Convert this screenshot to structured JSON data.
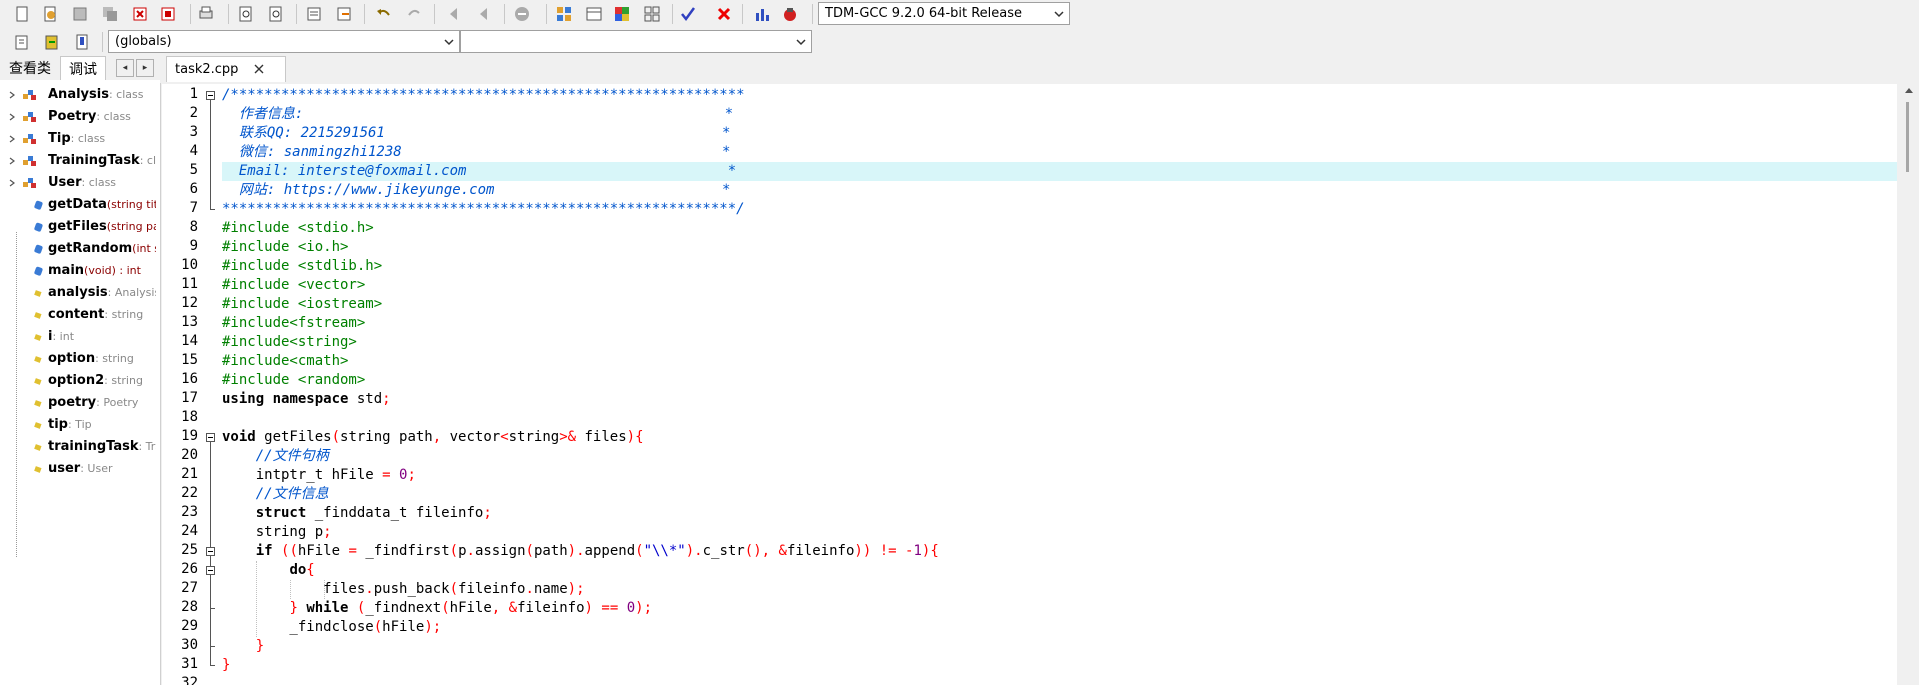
{
  "toolbar": {
    "compiler_select": "TDM-GCC 9.2.0 64-bit Release",
    "icons": [
      "new-file-icon",
      "open-file-icon",
      "save-icon",
      "save-all-icon",
      "close-icon",
      "close-all-icon",
      "print-icon",
      "find-icon",
      "replace-icon",
      "goto-icon",
      "toggle-icon",
      "undo-icon",
      "redo-icon",
      "indent-icon",
      "unindent-icon",
      "comment-icon",
      "compile-icon",
      "run-icon",
      "compile-run-icon",
      "rebuild-icon",
      "check-syntax-icon",
      "stop-icon",
      "chart-icon",
      "debug-icon"
    ]
  },
  "toolbar2": {
    "scope_select": "(globals)",
    "member_select": "",
    "icons": [
      "class-browser-icon",
      "goto-declaration-icon",
      "bookmark-icon"
    ]
  },
  "left_panel": {
    "tabs": [
      "查看类",
      "调试"
    ],
    "items": [
      {
        "name": "Analysis",
        "type": ": class",
        "kind": "class",
        "expandable": true
      },
      {
        "name": "Poetry",
        "type": ": class",
        "kind": "class",
        "expandable": true
      },
      {
        "name": "Tip",
        "type": ": class",
        "kind": "class",
        "expandable": true
      },
      {
        "name": "TrainingTask",
        "type": ": cla",
        "kind": "class",
        "expandable": true
      },
      {
        "name": "User",
        "type": ": class",
        "kind": "class",
        "expandable": true
      },
      {
        "name": "getData",
        "type": "(string title,",
        "kind": "func",
        "expandable": false
      },
      {
        "name": "getFiles",
        "type": "(string path",
        "kind": "func",
        "expandable": false
      },
      {
        "name": "getRandom",
        "type": "(int st,",
        "kind": "func",
        "expandable": false
      },
      {
        "name": "main",
        "type": "(void) : int",
        "kind": "func",
        "expandable": false
      },
      {
        "name": "analysis",
        "type": ": Analysis",
        "kind": "var",
        "expandable": false
      },
      {
        "name": "content",
        "type": ": string",
        "kind": "var",
        "expandable": false
      },
      {
        "name": "i",
        "type": ": int",
        "kind": "var",
        "expandable": false
      },
      {
        "name": "option",
        "type": ": string",
        "kind": "var",
        "expandable": false
      },
      {
        "name": "option2",
        "type": ": string",
        "kind": "var",
        "expandable": false
      },
      {
        "name": "poetry",
        "type": ": Poetry",
        "kind": "var",
        "expandable": false
      },
      {
        "name": "tip",
        "type": ": Tip",
        "kind": "var",
        "expandable": false
      },
      {
        "name": "trainingTask",
        "type": ": Tra",
        "kind": "var",
        "expandable": false
      },
      {
        "name": "user",
        "type": ": User",
        "kind": "var",
        "expandable": false
      }
    ]
  },
  "editor": {
    "tab_label": "task2.cpp",
    "highlight_line": 5,
    "lines": [
      "/*************************************************************",
      "  作者信息:                                                  *",
      "  联系QQ: 2215291561                                        *",
      "  微信: sanmingzhi1238                                      *",
      "  Email: interste@foxmail.com                               *",
      "  网站: https://www.jikeyunge.com                           *",
      "*************************************************************/",
      "#include <stdio.h>",
      "#include <io.h>",
      "#include <stdlib.h>",
      "#include <vector>",
      "#include <iostream>",
      "#include<fstream>",
      "#include<string>",
      "#include<cmath>",
      "#include <random>",
      "using namespace std;",
      "",
      "void getFiles(string path, vector<string>& files){",
      "    //文件句柄",
      "    intptr_t hFile = 0;",
      "    //文件信息",
      "    struct _finddata_t fileinfo;",
      "    string p;",
      "    if ((hFile = _findfirst(p.assign(path).append(\"\\\\*\").c_str(), &fileinfo)) != -1){",
      "        do{",
      "            files.push_back(fileinfo.name);",
      "        } while (_findnext(hFile, &fileinfo) == 0);",
      "        _findclose(hFile);",
      "    }",
      "}",
      ""
    ]
  }
}
